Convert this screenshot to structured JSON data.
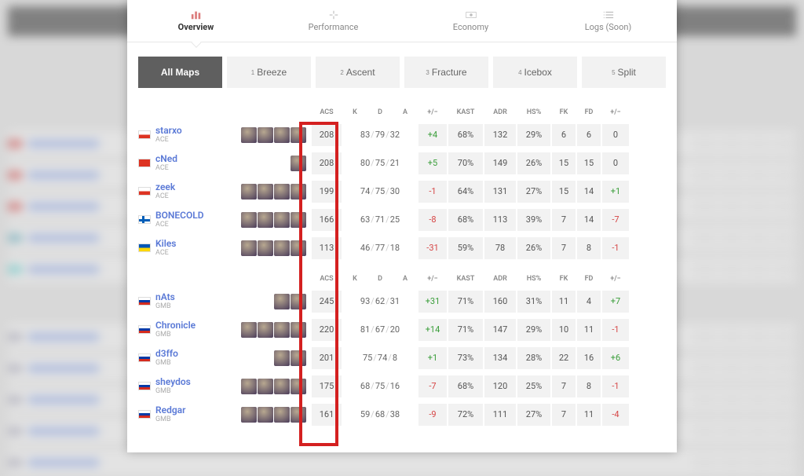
{
  "tabs_main": [
    {
      "label": "Overview",
      "active": true
    },
    {
      "label": "Performance",
      "active": false
    },
    {
      "label": "Economy",
      "active": false
    },
    {
      "label": "Logs (Soon)",
      "active": false
    }
  ],
  "maps": [
    {
      "num": "",
      "label": "All Maps",
      "active": true
    },
    {
      "num": "1",
      "label": "Breeze"
    },
    {
      "num": "2",
      "label": "Ascent"
    },
    {
      "num": "3",
      "label": "Fracture"
    },
    {
      "num": "4",
      "label": "Icebox"
    },
    {
      "num": "5",
      "label": "Split"
    }
  ],
  "headers": [
    "ACS",
    "K",
    "D",
    "A",
    "+/−",
    "KAST",
    "ADR",
    "HS%",
    "FK",
    "FD",
    "+/−"
  ],
  "team1": {
    "tag": "ACE",
    "players": [
      {
        "name": "starxo",
        "flag": "pl",
        "agents": 4,
        "acs": "208",
        "k": "83",
        "d": "79",
        "a": "32",
        "pm": "+4",
        "pm_sign": "pos",
        "kast": "68%",
        "adr": "132",
        "hs": "29%",
        "fk": "6",
        "fd": "6",
        "fpm": "0",
        "fpm_sign": ""
      },
      {
        "name": "cNed",
        "flag": "tr",
        "agents": 1,
        "acs": "208",
        "k": "80",
        "d": "75",
        "a": "21",
        "pm": "+5",
        "pm_sign": "pos",
        "kast": "70%",
        "adr": "149",
        "hs": "26%",
        "fk": "15",
        "fd": "15",
        "fpm": "0",
        "fpm_sign": ""
      },
      {
        "name": "zeek",
        "flag": "pl",
        "agents": 4,
        "acs": "199",
        "k": "74",
        "d": "75",
        "a": "30",
        "pm": "-1",
        "pm_sign": "neg",
        "kast": "64%",
        "adr": "131",
        "hs": "27%",
        "fk": "15",
        "fd": "14",
        "fpm": "+1",
        "fpm_sign": "pos"
      },
      {
        "name": "BONECOLD",
        "flag": "fi",
        "agents": 4,
        "acs": "166",
        "k": "63",
        "d": "71",
        "a": "25",
        "pm": "-8",
        "pm_sign": "neg",
        "kast": "68%",
        "adr": "113",
        "hs": "39%",
        "fk": "7",
        "fd": "14",
        "fpm": "-7",
        "fpm_sign": "neg"
      },
      {
        "name": "Kiles",
        "flag": "ua",
        "agents": 4,
        "acs": "113",
        "k": "46",
        "d": "77",
        "a": "18",
        "pm": "-31",
        "pm_sign": "neg",
        "kast": "59%",
        "adr": "78",
        "hs": "26%",
        "fk": "7",
        "fd": "8",
        "fpm": "-1",
        "fpm_sign": "neg"
      }
    ]
  },
  "team2": {
    "tag": "GMB",
    "players": [
      {
        "name": "nAts",
        "flag": "ru",
        "agents": 2,
        "acs": "245",
        "k": "93",
        "d": "62",
        "a": "31",
        "pm": "+31",
        "pm_sign": "pos",
        "kast": "71%",
        "adr": "160",
        "hs": "31%",
        "fk": "11",
        "fd": "4",
        "fpm": "+7",
        "fpm_sign": "pos"
      },
      {
        "name": "Chronicle",
        "flag": "ru",
        "agents": 4,
        "acs": "220",
        "k": "81",
        "d": "67",
        "a": "20",
        "pm": "+14",
        "pm_sign": "pos",
        "kast": "71%",
        "adr": "147",
        "hs": "29%",
        "fk": "10",
        "fd": "11",
        "fpm": "-1",
        "fpm_sign": "neg"
      },
      {
        "name": "d3ffo",
        "flag": "ru",
        "agents": 2,
        "acs": "201",
        "k": "75",
        "d": "74",
        "a": "8",
        "pm": "+1",
        "pm_sign": "pos",
        "kast": "73%",
        "adr": "134",
        "hs": "28%",
        "fk": "22",
        "fd": "16",
        "fpm": "+6",
        "fpm_sign": "pos"
      },
      {
        "name": "sheydos",
        "flag": "ru",
        "agents": 4,
        "acs": "175",
        "k": "68",
        "d": "75",
        "a": "16",
        "pm": "-7",
        "pm_sign": "neg",
        "kast": "68%",
        "adr": "120",
        "hs": "25%",
        "fk": "7",
        "fd": "8",
        "fpm": "-1",
        "fpm_sign": "neg"
      },
      {
        "name": "Redgar",
        "flag": "ru",
        "agents": 4,
        "acs": "161",
        "k": "59",
        "d": "68",
        "a": "38",
        "pm": "-9",
        "pm_sign": "neg",
        "kast": "72%",
        "adr": "111",
        "hs": "27%",
        "fk": "7",
        "fd": "11",
        "fpm": "-4",
        "fpm_sign": "neg"
      }
    ]
  }
}
